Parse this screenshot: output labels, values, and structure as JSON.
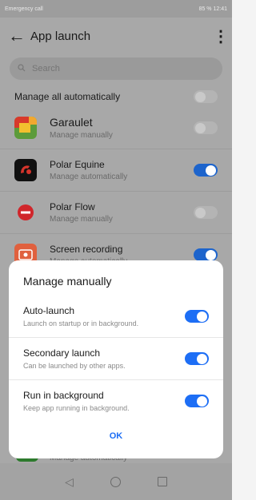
{
  "status_bar": {
    "left": "Emergency call",
    "right": "85 %  12:41"
  },
  "header": {
    "title": "App launch"
  },
  "search": {
    "placeholder": "Search"
  },
  "manage_all": {
    "label": "Manage all automatically",
    "on": false
  },
  "apps": [
    {
      "name": "Garaulet",
      "status": "Manage manually",
      "on": false,
      "icon": "garaulet-icon"
    },
    {
      "name": "Polar Equine",
      "status": "Manage automatically",
      "on": true,
      "icon": "polar-equine-icon"
    },
    {
      "name": "Polar Flow",
      "status": "Manage manually",
      "on": false,
      "icon": "polar-flow-icon"
    },
    {
      "name": "Screen recording",
      "status": "Manage automatically",
      "on": true,
      "icon": "screen-recording-icon"
    }
  ],
  "under_dialog_text": "Manage automatically",
  "dialog": {
    "title": "Manage manually",
    "options": [
      {
        "name": "Auto-launch",
        "desc": "Launch on startup or in background.",
        "on": true
      },
      {
        "name": "Secondary launch",
        "desc": "Can be launched by other apps.",
        "on": true
      },
      {
        "name": "Run in background",
        "desc": "Keep app running in background.",
        "on": true
      }
    ],
    "ok_label": "OK"
  },
  "colors": {
    "accent": "#1d6ef5",
    "toggle_on_dimmed": "#1d64cc"
  }
}
